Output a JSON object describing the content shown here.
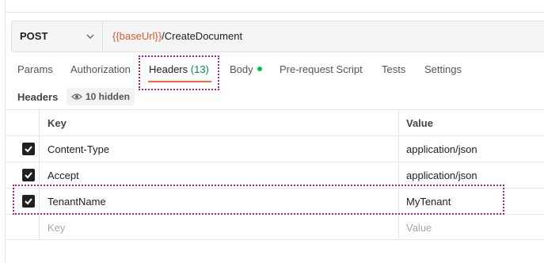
{
  "request": {
    "method": "POST",
    "url_variable": "{{baseUrl}}",
    "url_path": "/CreateDocument"
  },
  "tabs": [
    {
      "label": "Params"
    },
    {
      "label": "Authorization"
    },
    {
      "label": "Headers",
      "count": "(13)"
    },
    {
      "label": "Body"
    },
    {
      "label": "Pre-request Script"
    },
    {
      "label": "Tests"
    },
    {
      "label": "Settings"
    }
  ],
  "headers_section": {
    "title": "Headers",
    "hidden_label": "10 hidden"
  },
  "table": {
    "columns": {
      "key": "Key",
      "value": "Value"
    },
    "rows": [
      {
        "key": "Content-Type",
        "value": "application/json",
        "checked": true
      },
      {
        "key": "Accept",
        "value": "application/json",
        "checked": true
      },
      {
        "key": "TenantName",
        "value": "MyTenant",
        "checked": true
      }
    ],
    "placeholder": {
      "key": "Key",
      "value": "Value"
    }
  },
  "colors": {
    "accent": "#f26b3a",
    "variable": "#e05a2b",
    "highlight_outline": "#c2187e",
    "body_dot": "#0cbb52"
  }
}
